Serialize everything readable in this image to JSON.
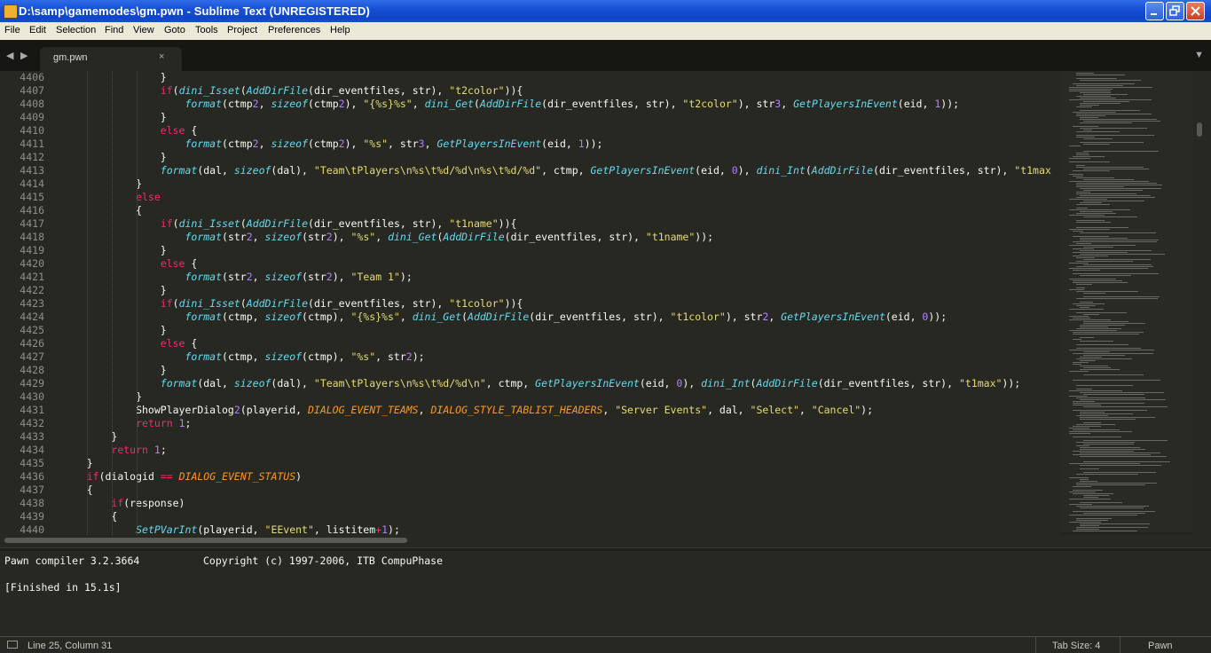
{
  "window": {
    "title": "D:\\samp\\gamemodes\\gm.pwn - Sublime Text (UNREGISTERED)",
    "controls": [
      "minimize",
      "restore",
      "close"
    ]
  },
  "menu": [
    "File",
    "Edit",
    "Selection",
    "Find",
    "View",
    "Goto",
    "Tools",
    "Project",
    "Preferences",
    "Help"
  ],
  "tabs": {
    "nav_back": "◀",
    "nav_forward": "▶",
    "active_tab": "gm.pwn",
    "close_glyph": "×",
    "menu_glyph": "▼"
  },
  "editor": {
    "theme_colors": {
      "background": "#272822",
      "keyword": "#f92672",
      "function": "#66d9ef",
      "string": "#e6db74",
      "number": "#ae81ff",
      "constant": "#fd971f"
    },
    "lines": [
      {
        "n": "4406",
        "segs": [
          [
            "p",
            "                }"
          ]
        ]
      },
      {
        "n": "4407",
        "segs": [
          [
            "p",
            "                "
          ],
          [
            "kw",
            "if"
          ],
          [
            "p",
            "("
          ],
          [
            "fn",
            "dini_Isset"
          ],
          [
            "p",
            "("
          ],
          [
            "fn",
            "AddDirFile"
          ],
          [
            "p",
            "(dir_eventfiles, str), "
          ],
          [
            "st",
            "\"t2color\""
          ],
          [
            "p",
            ")){"
          ]
        ]
      },
      {
        "n": "4408",
        "segs": [
          [
            "p",
            "                    "
          ],
          [
            "fn",
            "format"
          ],
          [
            "p",
            "(ctmp"
          ],
          [
            "nm",
            "2"
          ],
          [
            "p",
            ", "
          ],
          [
            "fn",
            "sizeof"
          ],
          [
            "p",
            "(ctmp"
          ],
          [
            "nm",
            "2"
          ],
          [
            "p",
            "), "
          ],
          [
            "st",
            "\"{%s}%s\""
          ],
          [
            "p",
            ", "
          ],
          [
            "fn",
            "dini_Get"
          ],
          [
            "p",
            "("
          ],
          [
            "fn",
            "AddDirFile"
          ],
          [
            "p",
            "(dir_eventfiles, str), "
          ],
          [
            "st",
            "\"t2color\""
          ],
          [
            "p",
            "), str"
          ],
          [
            "nm",
            "3"
          ],
          [
            "p",
            ", "
          ],
          [
            "fn",
            "GetPlayersInEvent"
          ],
          [
            "p",
            "(eid, "
          ],
          [
            "nm",
            "1"
          ],
          [
            "p",
            "));"
          ]
        ]
      },
      {
        "n": "4409",
        "segs": [
          [
            "p",
            "                }"
          ]
        ]
      },
      {
        "n": "4410",
        "segs": [
          [
            "p",
            "                "
          ],
          [
            "kw",
            "else"
          ],
          [
            "p",
            " {"
          ]
        ]
      },
      {
        "n": "4411",
        "segs": [
          [
            "p",
            "                    "
          ],
          [
            "fn",
            "format"
          ],
          [
            "p",
            "(ctmp"
          ],
          [
            "nm",
            "2"
          ],
          [
            "p",
            ", "
          ],
          [
            "fn",
            "sizeof"
          ],
          [
            "p",
            "(ctmp"
          ],
          [
            "nm",
            "2"
          ],
          [
            "p",
            "), "
          ],
          [
            "st",
            "\"%s\""
          ],
          [
            "p",
            ", str"
          ],
          [
            "nm",
            "3"
          ],
          [
            "p",
            ", "
          ],
          [
            "fn",
            "GetPlayersInEvent"
          ],
          [
            "p",
            "(eid, "
          ],
          [
            "nm",
            "1"
          ],
          [
            "p",
            "));"
          ]
        ]
      },
      {
        "n": "4412",
        "segs": [
          [
            "p",
            "                }"
          ]
        ]
      },
      {
        "n": "4413",
        "segs": [
          [
            "p",
            "                "
          ],
          [
            "fn",
            "format"
          ],
          [
            "p",
            "(dal, "
          ],
          [
            "fn",
            "sizeof"
          ],
          [
            "p",
            "(dal), "
          ],
          [
            "st",
            "\"Team\\tPlayers\\n%s\\t%d/%d\\n%s\\t%d/%d\""
          ],
          [
            "p",
            ", ctmp, "
          ],
          [
            "fn",
            "GetPlayersInEvent"
          ],
          [
            "p",
            "(eid, "
          ],
          [
            "nm",
            "0"
          ],
          [
            "p",
            "), "
          ],
          [
            "fn",
            "dini_Int"
          ],
          [
            "p",
            "("
          ],
          [
            "fn",
            "AddDirFile"
          ],
          [
            "p",
            "(dir_eventfiles, str), "
          ],
          [
            "st",
            "\"t1max"
          ]
        ]
      },
      {
        "n": "4414",
        "segs": [
          [
            "p",
            "            }"
          ]
        ]
      },
      {
        "n": "4415",
        "segs": [
          [
            "p",
            "            "
          ],
          [
            "kw",
            "else"
          ]
        ]
      },
      {
        "n": "4416",
        "segs": [
          [
            "p",
            "            {"
          ]
        ]
      },
      {
        "n": "4417",
        "segs": [
          [
            "p",
            "                "
          ],
          [
            "kw",
            "if"
          ],
          [
            "p",
            "("
          ],
          [
            "fn",
            "dini_Isset"
          ],
          [
            "p",
            "("
          ],
          [
            "fn",
            "AddDirFile"
          ],
          [
            "p",
            "(dir_eventfiles, str), "
          ],
          [
            "st",
            "\"t1name\""
          ],
          [
            "p",
            ")){"
          ]
        ]
      },
      {
        "n": "4418",
        "segs": [
          [
            "p",
            "                    "
          ],
          [
            "fn",
            "format"
          ],
          [
            "p",
            "(str"
          ],
          [
            "nm",
            "2"
          ],
          [
            "p",
            ", "
          ],
          [
            "fn",
            "sizeof"
          ],
          [
            "p",
            "(str"
          ],
          [
            "nm",
            "2"
          ],
          [
            "p",
            "), "
          ],
          [
            "st",
            "\"%s\""
          ],
          [
            "p",
            ", "
          ],
          [
            "fn",
            "dini_Get"
          ],
          [
            "p",
            "("
          ],
          [
            "fn",
            "AddDirFile"
          ],
          [
            "p",
            "(dir_eventfiles, str), "
          ],
          [
            "st",
            "\"t1name\""
          ],
          [
            "p",
            "));"
          ]
        ]
      },
      {
        "n": "4419",
        "segs": [
          [
            "p",
            "                }"
          ]
        ]
      },
      {
        "n": "4420",
        "segs": [
          [
            "p",
            "                "
          ],
          [
            "kw",
            "else"
          ],
          [
            "p",
            " {"
          ]
        ]
      },
      {
        "n": "4421",
        "segs": [
          [
            "p",
            "                    "
          ],
          [
            "fn",
            "format"
          ],
          [
            "p",
            "(str"
          ],
          [
            "nm",
            "2"
          ],
          [
            "p",
            ", "
          ],
          [
            "fn",
            "sizeof"
          ],
          [
            "p",
            "(str"
          ],
          [
            "nm",
            "2"
          ],
          [
            "p",
            "), "
          ],
          [
            "st",
            "\"Team 1\""
          ],
          [
            "p",
            ");"
          ]
        ]
      },
      {
        "n": "4422",
        "segs": [
          [
            "p",
            "                }"
          ]
        ]
      },
      {
        "n": "4423",
        "segs": [
          [
            "p",
            "                "
          ],
          [
            "kw",
            "if"
          ],
          [
            "p",
            "("
          ],
          [
            "fn",
            "dini_Isset"
          ],
          [
            "p",
            "("
          ],
          [
            "fn",
            "AddDirFile"
          ],
          [
            "p",
            "(dir_eventfiles, str), "
          ],
          [
            "st",
            "\"t1color\""
          ],
          [
            "p",
            ")){"
          ]
        ]
      },
      {
        "n": "4424",
        "segs": [
          [
            "p",
            "                    "
          ],
          [
            "fn",
            "format"
          ],
          [
            "p",
            "(ctmp, "
          ],
          [
            "fn",
            "sizeof"
          ],
          [
            "p",
            "(ctmp), "
          ],
          [
            "st",
            "\"{%s}%s\""
          ],
          [
            "p",
            ", "
          ],
          [
            "fn",
            "dini_Get"
          ],
          [
            "p",
            "("
          ],
          [
            "fn",
            "AddDirFile"
          ],
          [
            "p",
            "(dir_eventfiles, str), "
          ],
          [
            "st",
            "\"t1color\""
          ],
          [
            "p",
            "), str"
          ],
          [
            "nm",
            "2"
          ],
          [
            "p",
            ", "
          ],
          [
            "fn",
            "GetPlayersInEvent"
          ],
          [
            "p",
            "(eid, "
          ],
          [
            "nm",
            "0"
          ],
          [
            "p",
            "));"
          ]
        ]
      },
      {
        "n": "4425",
        "segs": [
          [
            "p",
            "                }"
          ]
        ]
      },
      {
        "n": "4426",
        "segs": [
          [
            "p",
            "                "
          ],
          [
            "kw",
            "else"
          ],
          [
            "p",
            " {"
          ]
        ]
      },
      {
        "n": "4427",
        "segs": [
          [
            "p",
            "                    "
          ],
          [
            "fn",
            "format"
          ],
          [
            "p",
            "(ctmp, "
          ],
          [
            "fn",
            "sizeof"
          ],
          [
            "p",
            "(ctmp), "
          ],
          [
            "st",
            "\"%s\""
          ],
          [
            "p",
            ", str"
          ],
          [
            "nm",
            "2"
          ],
          [
            "p",
            ");"
          ]
        ]
      },
      {
        "n": "4428",
        "segs": [
          [
            "p",
            "                }"
          ]
        ]
      },
      {
        "n": "4429",
        "segs": [
          [
            "p",
            "                "
          ],
          [
            "fn",
            "format"
          ],
          [
            "p",
            "(dal, "
          ],
          [
            "fn",
            "sizeof"
          ],
          [
            "p",
            "(dal), "
          ],
          [
            "st",
            "\"Team\\tPlayers\\n%s\\t%d/%d\\n\""
          ],
          [
            "p",
            ", ctmp, "
          ],
          [
            "fn",
            "GetPlayersInEvent"
          ],
          [
            "p",
            "(eid, "
          ],
          [
            "nm",
            "0"
          ],
          [
            "p",
            "), "
          ],
          [
            "fn",
            "dini_Int"
          ],
          [
            "p",
            "("
          ],
          [
            "fn",
            "AddDirFile"
          ],
          [
            "p",
            "(dir_eventfiles, str), "
          ],
          [
            "st",
            "\"t1max\""
          ],
          [
            "p",
            "));"
          ]
        ]
      },
      {
        "n": "4430",
        "segs": [
          [
            "p",
            "            }"
          ]
        ]
      },
      {
        "n": "4431",
        "segs": [
          [
            "p",
            "            ShowPlayerDialog"
          ],
          [
            "nm",
            "2"
          ],
          [
            "p",
            "(playerid, "
          ],
          [
            "cs",
            "DIALOG_EVENT_TEAMS"
          ],
          [
            "p",
            ", "
          ],
          [
            "cs",
            "DIALOG_STYLE_TABLIST_HEADERS"
          ],
          [
            "p",
            ", "
          ],
          [
            "st",
            "\"Server Events\""
          ],
          [
            "p",
            ", dal, "
          ],
          [
            "st",
            "\"Select\""
          ],
          [
            "p",
            ", "
          ],
          [
            "st",
            "\"Cancel\""
          ],
          [
            "p",
            ");"
          ]
        ]
      },
      {
        "n": "4432",
        "segs": [
          [
            "p",
            "            "
          ],
          [
            "kw",
            "return"
          ],
          [
            "p",
            " "
          ],
          [
            "nm",
            "1"
          ],
          [
            "p",
            ";"
          ]
        ]
      },
      {
        "n": "4433",
        "segs": [
          [
            "p",
            "        }"
          ]
        ]
      },
      {
        "n": "4434",
        "segs": [
          [
            "p",
            "        "
          ],
          [
            "kw",
            "return"
          ],
          [
            "p",
            " "
          ],
          [
            "nm",
            "1"
          ],
          [
            "p",
            ";"
          ]
        ]
      },
      {
        "n": "4435",
        "segs": [
          [
            "p",
            "    }"
          ]
        ]
      },
      {
        "n": "4436",
        "segs": [
          [
            "p",
            "    "
          ],
          [
            "kw",
            "if"
          ],
          [
            "p",
            "(dialogid "
          ],
          [
            "kw",
            "=="
          ],
          [
            "p",
            " "
          ],
          [
            "cs",
            "DIALOG_EVENT_STATUS"
          ],
          [
            "p",
            ")"
          ]
        ]
      },
      {
        "n": "4437",
        "segs": [
          [
            "p",
            "    {"
          ]
        ]
      },
      {
        "n": "4438",
        "segs": [
          [
            "p",
            "        "
          ],
          [
            "kw",
            "if"
          ],
          [
            "p",
            "(response)"
          ]
        ]
      },
      {
        "n": "4439",
        "segs": [
          [
            "p",
            "        {"
          ]
        ]
      },
      {
        "n": "4440",
        "segs": [
          [
            "p",
            "            "
          ],
          [
            "fn",
            "SetPVarInt"
          ],
          [
            "p",
            "(playerid, "
          ],
          [
            "st",
            "\"EEvent\""
          ],
          [
            "p",
            ", listitem"
          ],
          [
            "kw",
            "+"
          ],
          [
            "nm",
            "1"
          ],
          [
            "p",
            ");"
          ]
        ]
      }
    ]
  },
  "output": {
    "compiler": "Pawn compiler 3.2.3664",
    "copyright": "Copyright (c) 1997-2006, ITB CompuPhase",
    "finished": "[Finished in 15.1s]"
  },
  "statusbar": {
    "position": "Line 25, Column 31",
    "tab_size": "Tab Size: 4",
    "syntax": "Pawn"
  }
}
